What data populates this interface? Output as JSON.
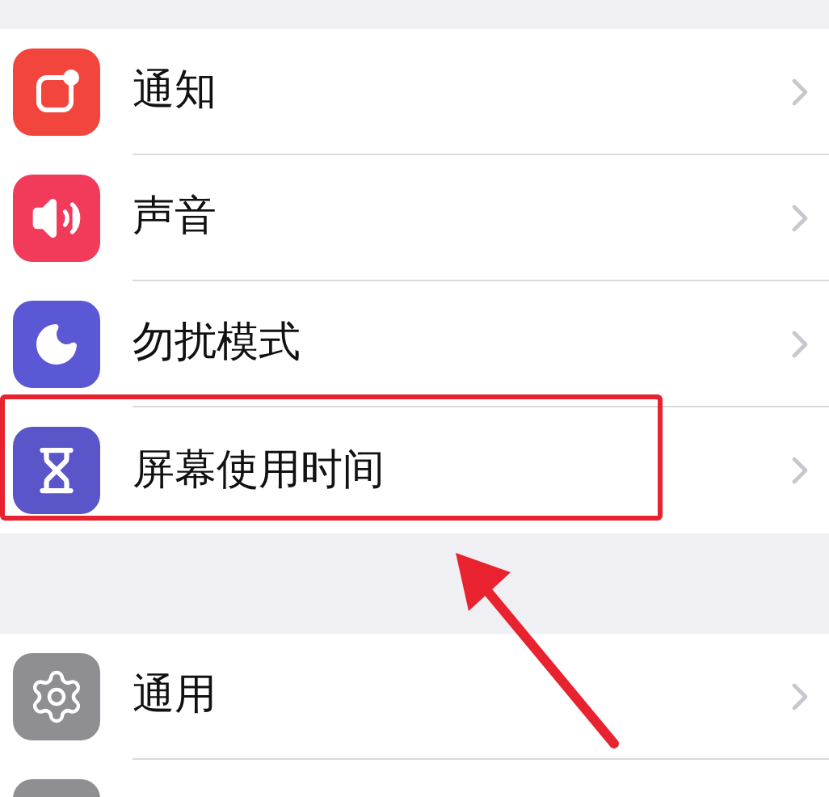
{
  "groups": [
    {
      "items": [
        {
          "kind": "notifications",
          "label": "通知",
          "highlighted": false
        },
        {
          "kind": "sounds",
          "label": "声音",
          "highlighted": false
        },
        {
          "kind": "dnd",
          "label": "勿扰模式",
          "highlighted": false
        },
        {
          "kind": "screentime",
          "label": "屏幕使用时间",
          "highlighted": true
        }
      ]
    },
    {
      "items": [
        {
          "kind": "general",
          "label": "通用",
          "highlighted": false
        },
        {
          "kind": "partial",
          "highlighted": false
        }
      ]
    }
  ]
}
